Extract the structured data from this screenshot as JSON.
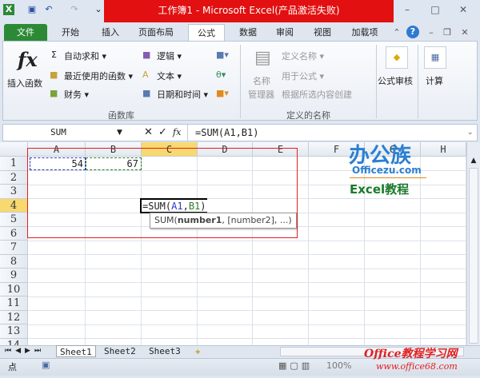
{
  "window": {
    "title": "工作簿1 - Microsoft Excel(产品激活失败)"
  },
  "tabs": [
    "文件",
    "开始",
    "插入",
    "页面布局",
    "公式",
    "数据",
    "审阅",
    "视图",
    "加载项"
  ],
  "ribbon": {
    "insert_function": "插入函数",
    "autosum": "自动求和 ▾",
    "recent": "最近使用的函数 ▾",
    "financial": "财务 ▾",
    "logical": "逻辑 ▾",
    "text": "文本 ▾",
    "datetime": "日期和时间 ▾",
    "group_library": "函数库",
    "name_manager_1": "名称",
    "name_manager_2": "管理器",
    "define_name": "定义名称 ▾",
    "use_in_formula": "用于公式 ▾",
    "create_from_selection": "根据所选内容创建",
    "group_names": "定义的名称",
    "formula_auditing": "公式审核",
    "calculation": "计算"
  },
  "formula_bar": {
    "name_box": "SUM",
    "formula": "=SUM(A1,B1)"
  },
  "columns": [
    "A",
    "B",
    "C",
    "D",
    "E",
    "F",
    "G",
    "H"
  ],
  "rows": [
    "1",
    "2",
    "3",
    "4",
    "5",
    "6",
    "7",
    "8",
    "9",
    "10",
    "11",
    "12",
    "13",
    "14"
  ],
  "cells": {
    "A1": "54",
    "B1": "67",
    "C4_prefix": "=SUM(",
    "C4_a": "A1",
    ",": ",",
    "C4_b": "B1",
    "C4_suffix": ")"
  },
  "tooltip": {
    "fn": "SUM(",
    "arg1": "number1",
    ",rest": ", [number2], ...)"
  },
  "sheets": [
    "Sheet1",
    "Sheet2",
    "Sheet3"
  ],
  "status": {
    "mode": "点",
    "zoom": "100%"
  },
  "watermarks": {
    "logo1": "办公族",
    "logo1_url": "Officezu.com",
    "logo1_sub": "Excel教程",
    "logo2": "Office教程学习网",
    "logo2_url": "www.office68.com"
  },
  "colors": {
    "title_bar": "#e21010",
    "file_tab": "#2c8a36",
    "selected_header": "#f7d96f",
    "ref_a1": "#2a3cc0",
    "ref_b1": "#2a7a2a",
    "annotation_box": "#e02020"
  }
}
